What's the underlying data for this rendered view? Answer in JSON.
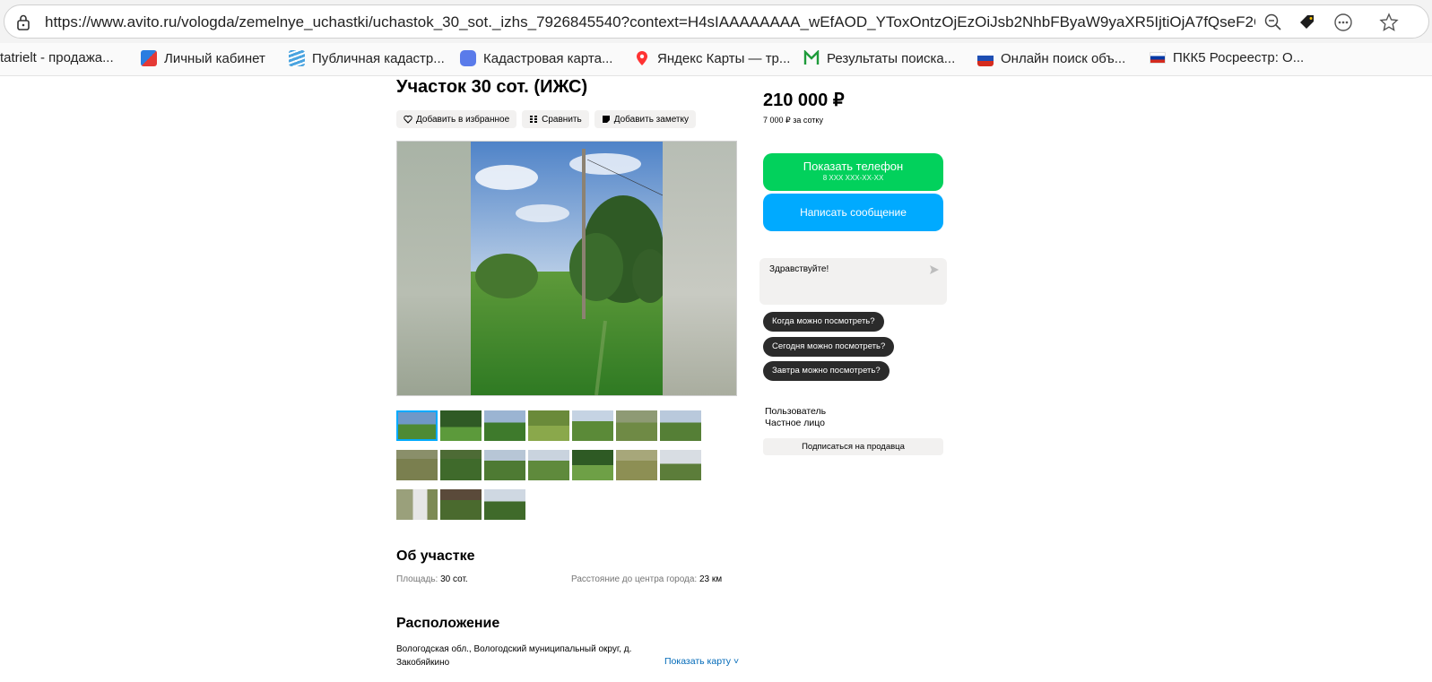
{
  "browser": {
    "url_full": "https://www.avito.ru/vologda/zemelnye_uchastki/uchastok_30_sot._izhs_7926845540?context=H4sIAAAAAAAA_wEfAOD_YToxOntzOjEzOiJsb2NhbFByaW9yaXR5IjtiOjA7fQseF2Qf...",
    "icons": [
      "lock-icon",
      "zoom-out-icon",
      "tag-icon",
      "more-icon",
      "favorite-star-icon"
    ]
  },
  "bookmarks": [
    {
      "label": "tatrielt - продажа...",
      "icon": "none"
    },
    {
      "label": "Личный кабинет",
      "icon": "gosuslugi-icon"
    },
    {
      "label": "Публичная кадастр...",
      "icon": "layers-icon"
    },
    {
      "label": "Кадастровая карта...",
      "icon": "map-app-icon"
    },
    {
      "label": "Яндекс Карты — тр...",
      "icon": "map-pin-icon"
    },
    {
      "label": "Результаты поиска...",
      "icon": "nspd-icon"
    },
    {
      "label": "Онлайн поиск объ...",
      "icon": "rosreestr-icon"
    },
    {
      "label": "ПКК5 Росреестр: О...",
      "icon": "russia-flag-icon"
    }
  ],
  "listing": {
    "title": "Участок 30 сот. (ИЖС)",
    "actions": {
      "favorite": "Добавить в избранное",
      "compare": "Сравнить",
      "note": "Добавить заметку"
    },
    "photos_count": 17
  },
  "about": {
    "heading": "Об участке",
    "area_label": "Площадь:",
    "area_value": "30 сот.",
    "distance_label": "Расстояние до центра города:",
    "distance_value": "23 км"
  },
  "location": {
    "heading": "Расположение",
    "address": "Вологодская обл., Вологодский муниципальный округ, д. Закобяйкино",
    "show_map": "Показать карту"
  },
  "sidebar": {
    "price": "210 000 ₽",
    "price_per_unit": "7 000 ₽ за сотку",
    "show_phone": "Показать телефон",
    "phone_mask": "8 XXX XXX-XX-XX",
    "write_message": "Написать сообщение",
    "chat_greeting": "Здравствуйте!",
    "quick_replies": [
      "Когда можно посмотреть?",
      "Сегодня можно посмотреть?",
      "Завтра можно посмотреть?"
    ],
    "seller_name": "Пользователь",
    "seller_type": "Частное лицо",
    "subscribe": "Подписаться на продавца"
  },
  "colors": {
    "green_button": "#02d15c",
    "blue_button": "#00aaff",
    "chip_bg": "#2b2b2b",
    "link": "#0069b8"
  }
}
